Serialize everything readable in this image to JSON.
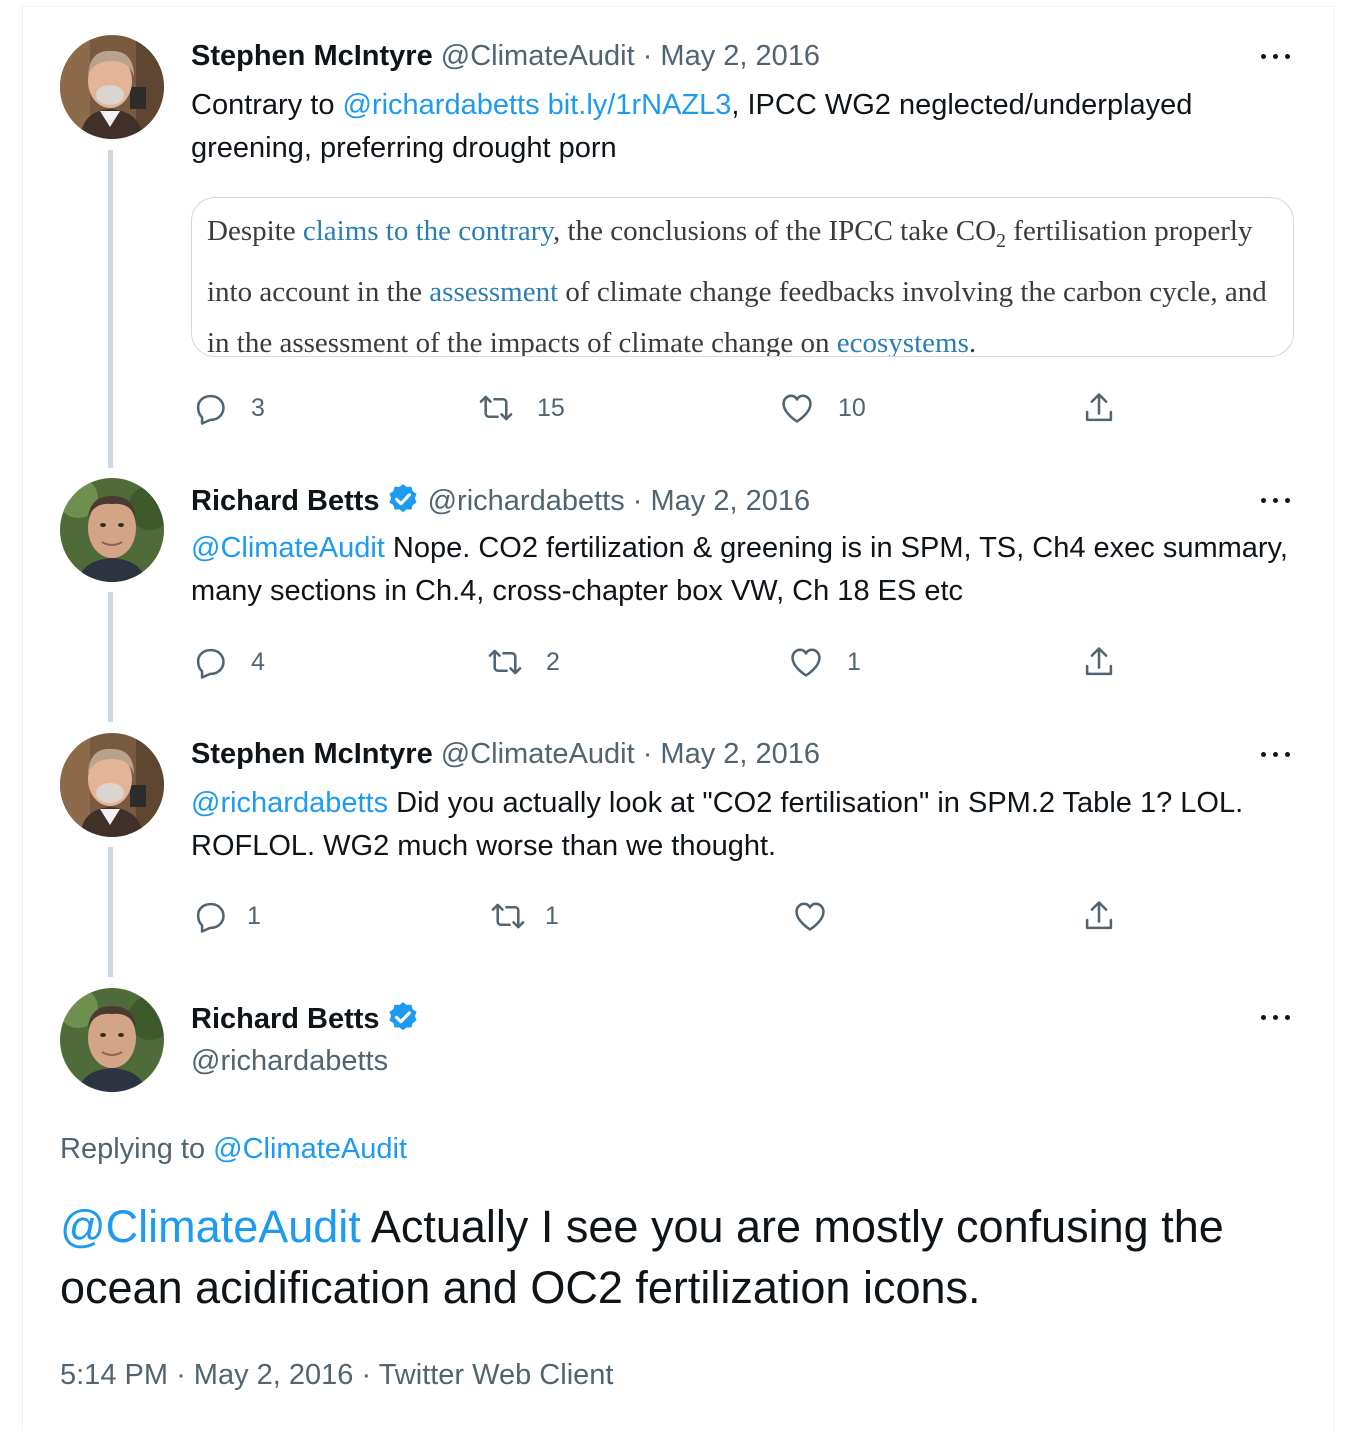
{
  "tweets": [
    {
      "name": "Stephen McIntyre",
      "handle": "@ClimateAudit",
      "sep": "·",
      "date": "May 2, 2016",
      "text_pre": "Contrary to ",
      "mention": "@richardabetts",
      "link": "bit.ly/1rNAZL3",
      "text_post": ", IPCC WG2 neglected/underplayed greening, preferring drought porn",
      "quote": {
        "t1": "Despite ",
        "l1": "claims to the contrary",
        "t2": ", the conclusions of the IPCC take CO",
        "sub": "2",
        "t3": " fertilisation properly into account in the ",
        "l2": "assessment",
        "t4": " of climate change feedbacks involving the carbon cycle, and in the assessment of the impacts of climate change on ",
        "l3": "ecosystems",
        "t5": "."
      },
      "replies": "3",
      "retweets": "15",
      "likes": "10"
    },
    {
      "name": "Richard Betts",
      "handle": "@richardabetts",
      "sep": "·",
      "date": "May 2, 2016",
      "mention": "@ClimateAudit",
      "text": " Nope. CO2 fertilization & greening is in SPM, TS, Ch4 exec summary, many sections in Ch.4, cross-chapter box VW, Ch 18 ES etc",
      "replies": "4",
      "retweets": "2",
      "likes": "1"
    },
    {
      "name": "Stephen McIntyre",
      "handle": "@ClimateAudit",
      "sep": "·",
      "date": "May 2, 2016",
      "mention": "@richardabetts",
      "text": " Did you actually look at \"CO2 fertilisation\" in SPM.2 Table 1? LOL. ROFLOL. WG2 much worse than we thought.",
      "replies": "1",
      "retweets": "1",
      "likes": ""
    }
  ],
  "main": {
    "name": "Richard Betts",
    "handle": "@richardabetts",
    "replying_label": "Replying to ",
    "replying_handle": "@ClimateAudit",
    "mention": "@ClimateAudit",
    "text": " Actually I see you are mostly confusing the ocean acidification and OC2 fertilization icons.",
    "time": "5:14 PM",
    "sep": "·",
    "date": "May 2, 2016",
    "client": "Twitter Web Client"
  },
  "colors": {
    "link": "#1d9bf0",
    "secondary": "#536471",
    "verified": "#1d9bf0",
    "thread_line": "#cfd9de"
  },
  "icons": [
    "reply-icon",
    "retweet-icon",
    "like-icon",
    "share-icon",
    "more-icon",
    "verified-badge-icon"
  ]
}
